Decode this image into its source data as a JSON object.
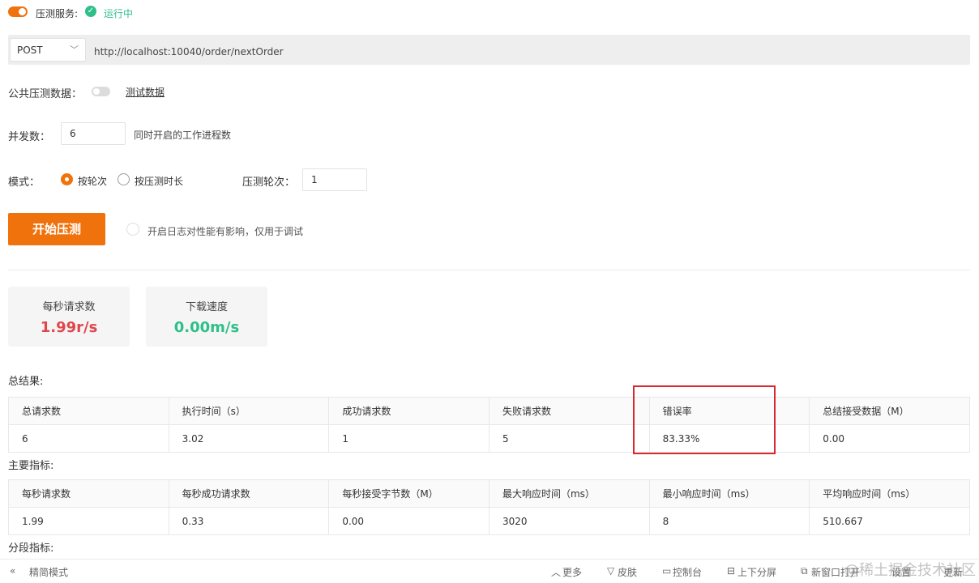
{
  "service": {
    "label": "压测服务:",
    "status": "运行中"
  },
  "request": {
    "method": "POST",
    "url": "http://localhost:10040/order/nextOrder"
  },
  "public_data": {
    "label": "公共压测数据：",
    "link": "测试数据"
  },
  "concurrency": {
    "label": "并发数：",
    "value": "6",
    "hint": "同时开启的工作进程数"
  },
  "mode": {
    "label": "模式：",
    "option_rounds": "按轮次",
    "option_duration": "按压测时长",
    "rounds_label": "压测轮次：",
    "rounds_value": "1"
  },
  "start": {
    "button": "开始压测",
    "log_hint": "开启日志对性能有影响，仅用于调试"
  },
  "stats": {
    "rps": {
      "title": "每秒请求数",
      "value": "1.99r/s",
      "color": "#e0474c"
    },
    "download": {
      "title": "下载速度",
      "value": "0.00m/s",
      "color": "#2fbf8a"
    }
  },
  "summary": {
    "label": "总结果:",
    "headers": [
      "总请求数",
      "执行时间（s）",
      "成功请求数",
      "失败请求数",
      "错误率",
      "总结接受数据（M）"
    ],
    "values": [
      "6",
      "3.02",
      "1",
      "5",
      "83.33%",
      "0.00"
    ]
  },
  "metrics": {
    "label": "主要指标:",
    "headers": [
      "每秒请求数",
      "每秒成功请求数",
      "每秒接受字节数（M）",
      "最大响应时间（ms）",
      "最小响应时间（ms）",
      "平均响应时间（ms）"
    ],
    "values": [
      "1.99",
      "0.33",
      "0.00",
      "3020",
      "8",
      "510.667"
    ]
  },
  "segments": {
    "label": "分段指标:"
  },
  "bottom": {
    "simple_mode": "精简模式",
    "more": "更多",
    "skin": "皮肤",
    "console": "控制台",
    "split": "上下分屏",
    "new_window": "新窗口打开",
    "settings": "设置",
    "update": "更新",
    "watermark": "@稀土掘金技术社区"
  }
}
